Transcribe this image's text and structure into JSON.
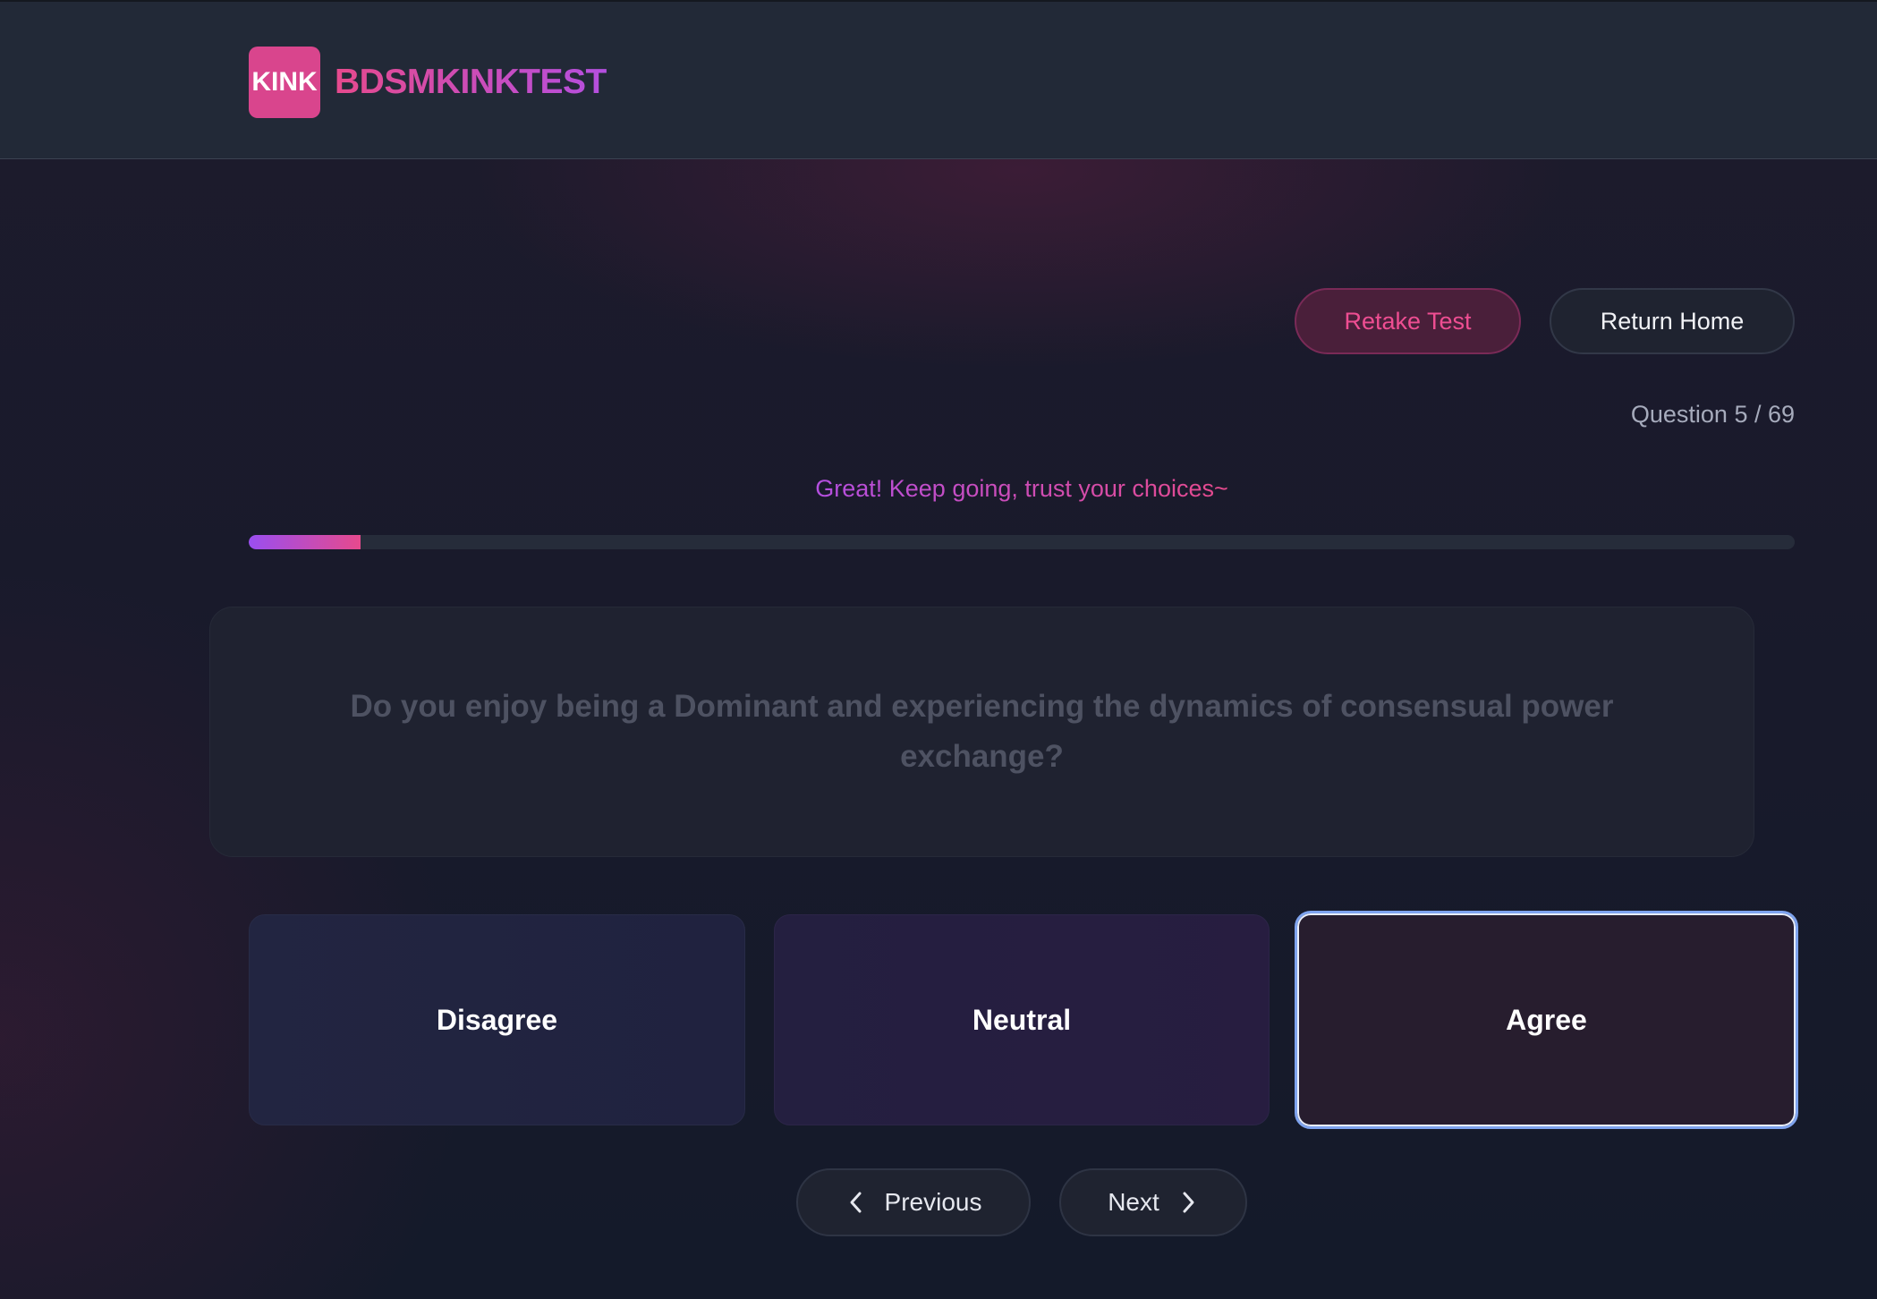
{
  "header": {
    "logo_text": "KINK",
    "brand_name": "BDSMKINKTEST"
  },
  "actions": {
    "retake_label": "Retake Test",
    "home_label": "Return Home"
  },
  "progress": {
    "counter_text": "Question 5 / 69",
    "current": 5,
    "total": 69,
    "encouragement": "Great! Keep going, trust your choices~"
  },
  "question": {
    "text": "Do you enjoy being a Dominant and experiencing the dynamics of consensual power exchange?"
  },
  "answers": [
    {
      "label": "Disagree",
      "selected": false
    },
    {
      "label": "Neutral",
      "selected": false
    },
    {
      "label": "Agree",
      "selected": true
    }
  ],
  "navigation": {
    "previous_label": "Previous",
    "next_label": "Next",
    "previous_icon": "chevron-left-icon",
    "next_icon": "chevron-right-icon"
  },
  "colors": {
    "accent_pink": "#e64a8d",
    "accent_purple": "#b44fe0",
    "selected_border": "#7ea3ee"
  }
}
